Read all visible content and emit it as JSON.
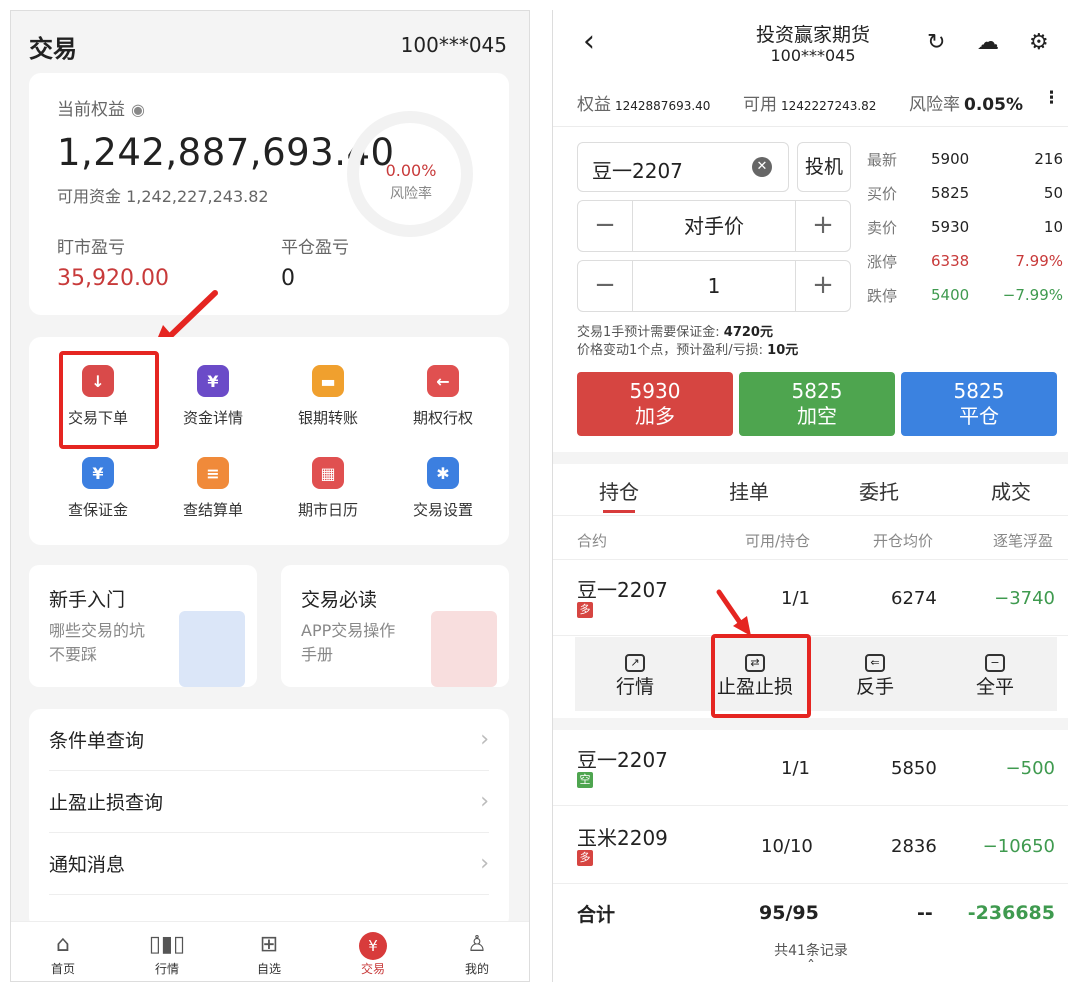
{
  "left": {
    "title": "交易",
    "account": "100***045",
    "equity": {
      "label": "当前权益",
      "value": "1,242,887,693.40",
      "available": "可用资金 1,242,227,243.82",
      "risk_pct": "0.00%",
      "risk_label": "风险率",
      "mtm_label": "盯市盈亏",
      "mtm_value": "35,920.00",
      "close_label": "平仓盈亏",
      "close_value": "0"
    },
    "grid": [
      {
        "label": "交易下单",
        "icon": "↓",
        "icon_name": "order-arrow-icon",
        "color": "#d94a4a"
      },
      {
        "label": "资金详情",
        "icon": "¥",
        "icon_name": "money-bag-icon",
        "color": "#6b4bc8"
      },
      {
        "label": "银期转账",
        "icon": "▬",
        "icon_name": "bank-card-icon",
        "color": "#f0a02e"
      },
      {
        "label": "期权行权",
        "icon": "←",
        "icon_name": "exercise-icon",
        "color": "#e05050"
      },
      {
        "label": "查保证金",
        "icon": "¥",
        "icon_name": "shield-icon",
        "color": "#3c7fe0"
      },
      {
        "label": "查结算单",
        "icon": "≡",
        "icon_name": "document-icon",
        "color": "#f08a3a"
      },
      {
        "label": "期市日历",
        "icon": "▦",
        "icon_name": "calendar-icon",
        "color": "#e05050"
      },
      {
        "label": "交易设置",
        "icon": "✱",
        "icon_name": "settings-icon",
        "color": "#3c7fe0"
      }
    ],
    "promos": [
      {
        "title": "新手入门",
        "sub": "哪些交易的坑不要踩",
        "color": "#dbe6f8"
      },
      {
        "title": "交易必读",
        "sub": "APP交易操作手册",
        "color": "#f8dede"
      }
    ],
    "links": [
      "条件单查询",
      "止盈止损查询",
      "通知消息"
    ],
    "tabs": [
      {
        "label": "首页",
        "icon": "⌂"
      },
      {
        "label": "行情",
        "icon": "▯▮▯"
      },
      {
        "label": "自选",
        "icon": "⊞"
      },
      {
        "label": "交易",
        "icon": "¥"
      },
      {
        "label": "我的",
        "icon": "♙"
      }
    ]
  },
  "right": {
    "title": "投资赢家期货",
    "account": "100***045",
    "summary": {
      "equity_label": "权益",
      "equity_value": "1242887693.40",
      "avail_label": "可用",
      "avail_value": "1242227243.82",
      "risk_label": "风险率",
      "risk_value": "0.05%"
    },
    "contract": "豆一2207",
    "spec": "投机",
    "price_mode": "对手价",
    "quantity": "1",
    "quote": [
      {
        "label": "最新",
        "price": "5900",
        "vol": "216",
        "pc": "#222",
        "vc": "#222"
      },
      {
        "label": "买价",
        "price": "5825",
        "vol": "50",
        "pc": "#222",
        "vc": "#222"
      },
      {
        "label": "卖价",
        "price": "5930",
        "vol": "10",
        "pc": "#222",
        "vc": "#222"
      },
      {
        "label": "涨停",
        "price": "6338",
        "vol": "7.99%",
        "pc": "#c83a3a",
        "vc": "#c83a3a"
      },
      {
        "label": "跌停",
        "price": "5400",
        "vol": "−7.99%",
        "pc": "#3f9a4f",
        "vc": "#3f9a4f"
      }
    ],
    "note_line1_a": "交易1手预计需要保证金:",
    "note_line1_b": "4720元",
    "note_line2_a": "价格变动1个点，预计盈利/亏损:",
    "note_line2_b": "10元",
    "buttons": [
      {
        "price": "5930",
        "label": "加多",
        "color": "#d64541"
      },
      {
        "price": "5825",
        "label": "加空",
        "color": "#4ea54f"
      },
      {
        "price": "5825",
        "label": "平仓",
        "color": "#3b82e0"
      }
    ],
    "tabs": [
      "持仓",
      "挂单",
      "委托",
      "成交"
    ],
    "columns": [
      "合约",
      "可用/持仓",
      "开仓均价",
      "逐笔浮盈"
    ],
    "positions": [
      {
        "name": "豆一2207",
        "badge": "多",
        "badge_color": "#d64541",
        "qty": "1/1",
        "avg": "6274",
        "pnl": "−3740"
      },
      {
        "name": "豆一2207",
        "badge": "空",
        "badge_color": "#4ea54f",
        "qty": "1/1",
        "avg": "5850",
        "pnl": "−500"
      },
      {
        "name": "玉米2209",
        "badge": "多",
        "badge_color": "#d64541",
        "qty": "10/10",
        "avg": "2836",
        "pnl": "−10650"
      }
    ],
    "actions": [
      {
        "label": "行情",
        "icon": "↗",
        "icon_name": "chart-trend-icon"
      },
      {
        "label": "止盈止损",
        "icon": "⇄",
        "icon_name": "stop-loss-icon"
      },
      {
        "label": "反手",
        "icon": "⇐",
        "icon_name": "reverse-icon"
      },
      {
        "label": "全平",
        "icon": "−",
        "icon_name": "close-all-icon"
      }
    ],
    "total": {
      "label": "合计",
      "qty": "95/95",
      "avg": "--",
      "pnl": "-236685"
    },
    "footer": "共41条记录"
  }
}
